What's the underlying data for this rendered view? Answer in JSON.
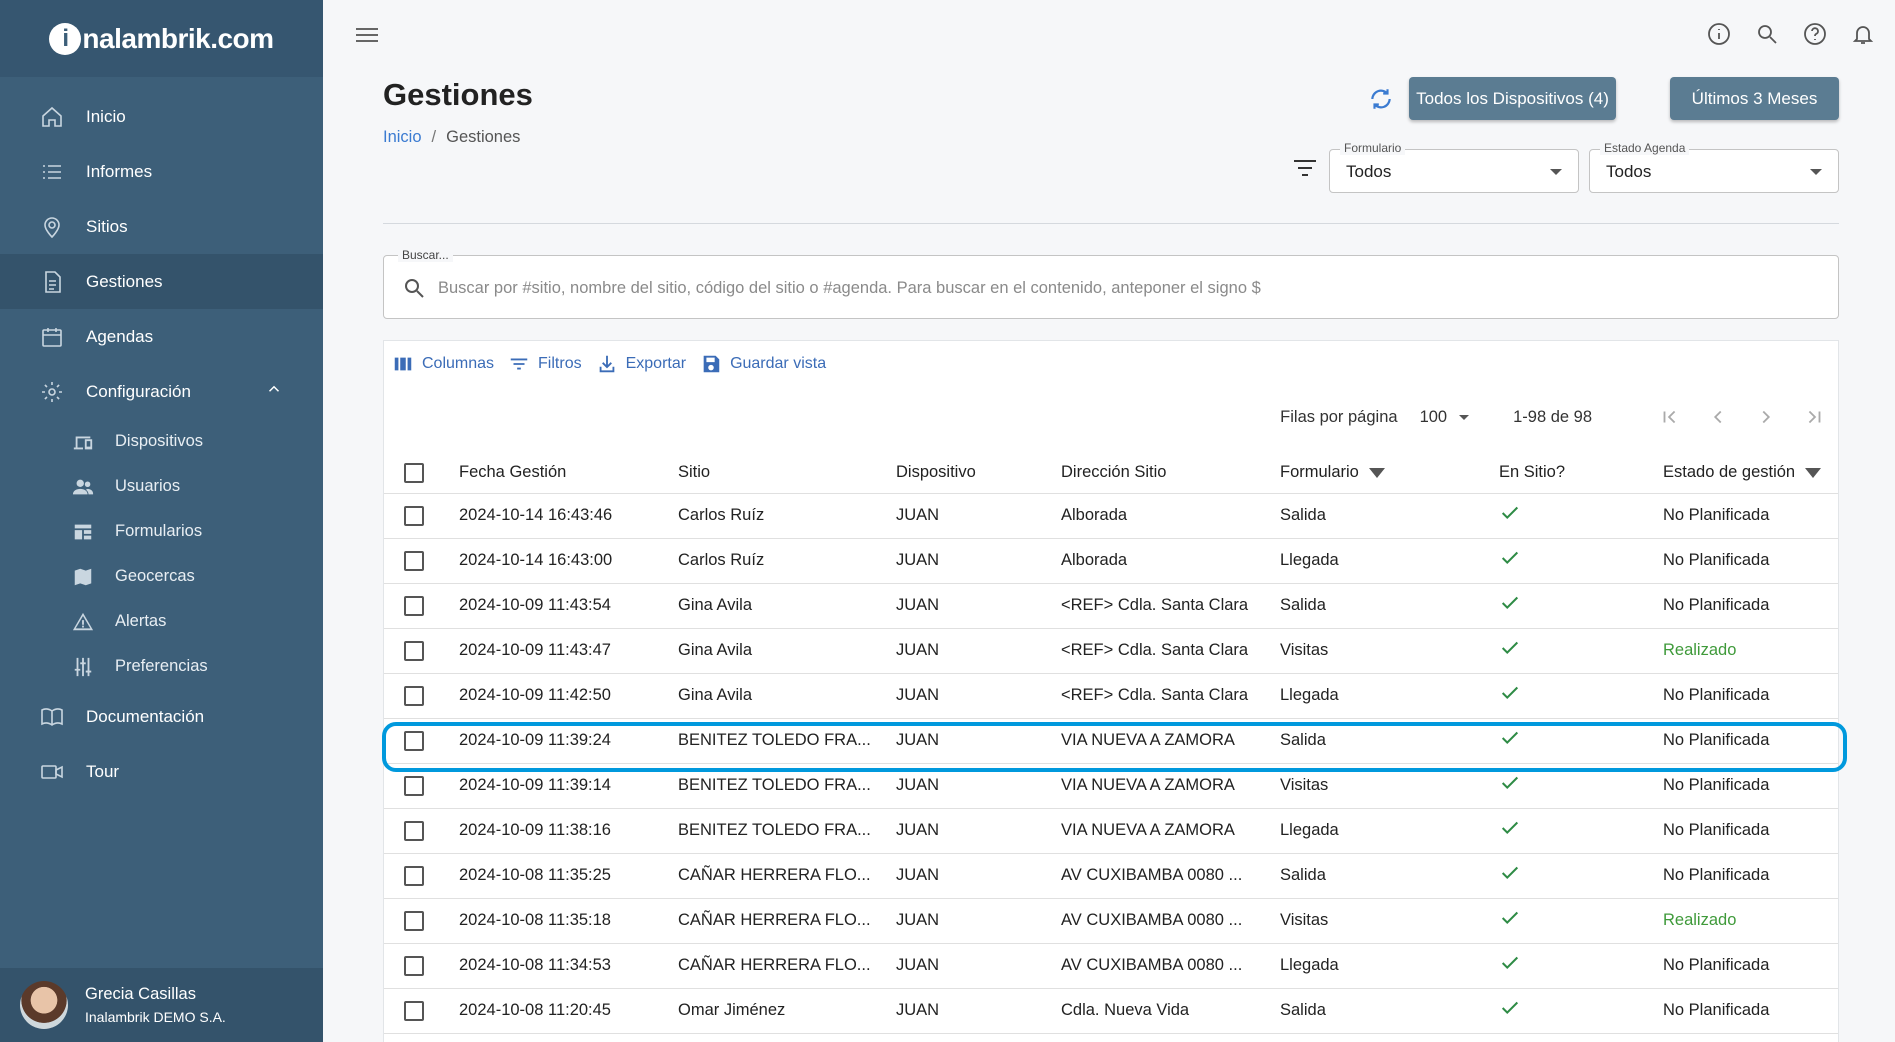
{
  "app": {
    "logo_text": "nalambrik.com",
    "logo_i": "i"
  },
  "sidebar": {
    "items": [
      {
        "label": "Inicio",
        "icon": "home-icon"
      },
      {
        "label": "Informes",
        "icon": "list-icon"
      },
      {
        "label": "Sitios",
        "icon": "location-pin-icon"
      },
      {
        "label": "Gestiones",
        "icon": "document-icon"
      },
      {
        "label": "Agendas",
        "icon": "calendar-icon"
      },
      {
        "label": "Configuración",
        "icon": "gear-icon"
      }
    ],
    "sub_items": [
      {
        "label": "Dispositivos",
        "icon": "devices-icon"
      },
      {
        "label": "Usuarios",
        "icon": "users-icon"
      },
      {
        "label": "Formularios",
        "icon": "forms-icon"
      },
      {
        "label": "Geocercas",
        "icon": "map-icon"
      },
      {
        "label": "Alertas",
        "icon": "warning-icon"
      },
      {
        "label": "Preferencias",
        "icon": "sliders-icon"
      }
    ],
    "bottom_items": [
      {
        "label": "Documentación",
        "icon": "book-icon"
      },
      {
        "label": "Tour",
        "icon": "video-icon"
      }
    ],
    "user": {
      "name": "Grecia Casillas",
      "org": "Inalambrik DEMO S.A."
    }
  },
  "header": {
    "title": "Gestiones",
    "breadcrumb": {
      "home": "Inicio",
      "separator": "/",
      "current": "Gestiones"
    },
    "btn_devices": "Todos los Dispositivos (4)",
    "btn_range": "Últimos 3 Meses",
    "formulario": {
      "label": "Formulario",
      "value": "Todos"
    },
    "estado_agenda": {
      "label": "Estado Agenda",
      "value": "Todos"
    }
  },
  "search": {
    "label": "Buscar...",
    "placeholder": "Buscar por #sitio, nombre del sitio, código del sitio o #agenda. Para buscar en el contenido, anteponer el signo $"
  },
  "toolbar": {
    "columns": "Columnas",
    "filters": "Filtros",
    "export": "Exportar",
    "save_view": "Guardar vista"
  },
  "pagination": {
    "rows_label": "Filas por página",
    "rows_value": "100",
    "range": "1-98 de 98"
  },
  "table": {
    "headers": [
      "Fecha Gestión",
      "Sitio",
      "Dispositivo",
      "Dirección Sitio",
      "Formulario",
      "En Sitio?",
      "Estado de gestión"
    ],
    "rows": [
      {
        "fecha": "2024-10-14 16:43:46",
        "sitio": "Carlos Ruíz",
        "disp": "JUAN",
        "dir": "Alborada",
        "form": "Salida",
        "estado": "No Planificada"
      },
      {
        "fecha": "2024-10-14 16:43:00",
        "sitio": "Carlos Ruíz",
        "disp": "JUAN",
        "dir": "Alborada",
        "form": "Llegada",
        "estado": "No Planificada"
      },
      {
        "fecha": "2024-10-09 11:43:54",
        "sitio": "Gina Avila",
        "disp": "JUAN",
        "dir": "<REF> Cdla. Santa Clara",
        "form": "Salida",
        "estado": "No Planificada"
      },
      {
        "fecha": "2024-10-09 11:43:47",
        "sitio": "Gina Avila",
        "disp": "JUAN",
        "dir": "<REF> Cdla. Santa Clara",
        "form": "Visitas",
        "estado": "Realizado"
      },
      {
        "fecha": "2024-10-09 11:42:50",
        "sitio": "Gina Avila",
        "disp": "JUAN",
        "dir": "<REF> Cdla. Santa Clara",
        "form": "Llegada",
        "estado": "No Planificada"
      },
      {
        "fecha": "2024-10-09 11:39:24",
        "sitio": "BENITEZ TOLEDO FRA...",
        "disp": "JUAN",
        "dir": "VIA NUEVA A ZAMORA",
        "form": "Salida",
        "estado": "No Planificada"
      },
      {
        "fecha": "2024-10-09 11:39:14",
        "sitio": "BENITEZ TOLEDO FRA...",
        "disp": "JUAN",
        "dir": "VIA NUEVA A ZAMORA",
        "form": "Visitas",
        "estado": "No Planificada"
      },
      {
        "fecha": "2024-10-09 11:38:16",
        "sitio": "BENITEZ TOLEDO FRA...",
        "disp": "JUAN",
        "dir": "VIA NUEVA A ZAMORA",
        "form": "Llegada",
        "estado": "No Planificada"
      },
      {
        "fecha": "2024-10-08 11:35:25",
        "sitio": "CAÑAR HERRERA FLO...",
        "disp": "JUAN",
        "dir": "AV CUXIBAMBA 0080 ...",
        "form": "Salida",
        "estado": "No Planificada"
      },
      {
        "fecha": "2024-10-08 11:35:18",
        "sitio": "CAÑAR HERRERA FLO...",
        "disp": "JUAN",
        "dir": "AV CUXIBAMBA 0080 ...",
        "form": "Visitas",
        "estado": "Realizado"
      },
      {
        "fecha": "2024-10-08 11:34:53",
        "sitio": "CAÑAR HERRERA FLO...",
        "disp": "JUAN",
        "dir": "AV CUXIBAMBA 0080 ...",
        "form": "Llegada",
        "estado": "No Planificada"
      },
      {
        "fecha": "2024-10-08 11:20:45",
        "sitio": "Omar Jiménez",
        "disp": "JUAN",
        "dir": "Cdla. Nueva Vida",
        "form": "Salida",
        "estado": "No Planificada"
      }
    ]
  },
  "colors": {
    "sidebar": "#3d5f79",
    "accent": "#3b7bd1",
    "success": "#2e8b45",
    "highlight": "#0099dd"
  }
}
